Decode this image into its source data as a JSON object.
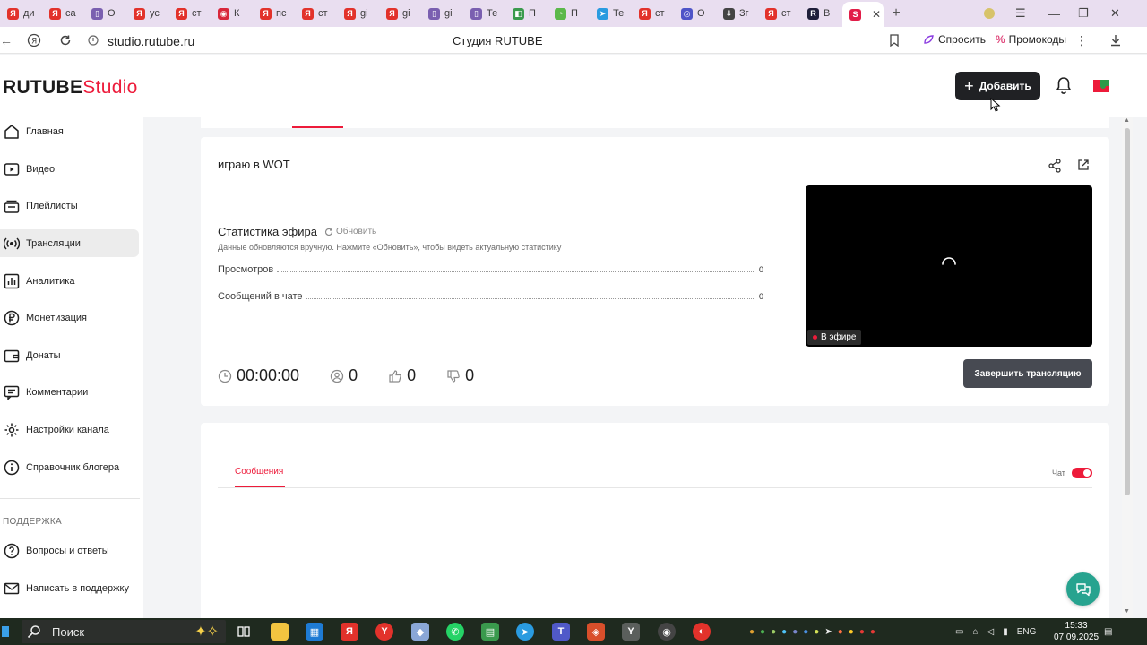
{
  "browser": {
    "tabs": [
      {
        "fav": "Я",
        "label": "ди",
        "color": "#e2322b"
      },
      {
        "fav": "Я",
        "label": "са",
        "color": "#e2322b"
      },
      {
        "fav": "▯",
        "label": "О",
        "color": "#7a5fb0"
      },
      {
        "fav": "Я",
        "label": "ус",
        "color": "#e2322b"
      },
      {
        "fav": "Я",
        "label": "ст",
        "color": "#e2322b"
      },
      {
        "fav": "◉",
        "label": "К",
        "color": "#d8263a"
      },
      {
        "fav": "Я",
        "label": "пс",
        "color": "#e2322b"
      },
      {
        "fav": "Я",
        "label": "ст",
        "color": "#e2322b"
      },
      {
        "fav": "Я",
        "label": "gi",
        "color": "#e2322b"
      },
      {
        "fav": "Я",
        "label": "gi",
        "color": "#e2322b"
      },
      {
        "fav": "▯",
        "label": "gi",
        "color": "#7a5fb0"
      },
      {
        "fav": "▯",
        "label": "Те",
        "color": "#7a5fb0"
      },
      {
        "fav": "◧",
        "label": "П",
        "color": "#3a9a4d"
      },
      {
        "fav": "◔",
        "label": "П",
        "color": "#5bb84a"
      },
      {
        "fav": "➤",
        "label": "Те",
        "color": "#2a9be0"
      },
      {
        "fav": "Я",
        "label": "ст",
        "color": "#e2322b"
      },
      {
        "fav": "◎",
        "label": "О",
        "color": "#4e54c8"
      },
      {
        "fav": "⇩",
        "label": "Зг",
        "color": "#444444"
      },
      {
        "fav": "Я",
        "label": "ст",
        "color": "#e2322b"
      },
      {
        "fav": "R",
        "label": "В",
        "color": "#1f1f3a"
      },
      {
        "fav": "S",
        "label": "",
        "color": "#e11d48",
        "active": true
      }
    ],
    "url": "studio.rutube.ru",
    "page_title": "Студия RUTUBE",
    "ask_label": "Спросить",
    "promo_label": "Промокоды"
  },
  "header": {
    "logo_main": "RUTUBE",
    "logo_studio": "Studio",
    "add_label": "Добавить"
  },
  "sidebar": {
    "items": [
      {
        "label": "Главная",
        "icon": "home-icon"
      },
      {
        "label": "Видео",
        "icon": "video-icon"
      },
      {
        "label": "Плейлисты",
        "icon": "playlist-icon"
      },
      {
        "label": "Трансляции",
        "icon": "broadcast-icon",
        "active": true
      },
      {
        "label": "Аналитика",
        "icon": "analytics-icon"
      },
      {
        "label": "Монетизация",
        "icon": "ruble-icon"
      },
      {
        "label": "Донаты",
        "icon": "wallet-icon"
      },
      {
        "label": "Комментарии",
        "icon": "comment-icon"
      },
      {
        "label": "Настройки канала",
        "icon": "gear-icon"
      },
      {
        "label": "Справочник блогера",
        "icon": "info-icon"
      }
    ],
    "support_heading": "ПОДДЕРЖКА",
    "support_items": [
      {
        "label": "Вопросы и ответы",
        "icon": "question-icon"
      },
      {
        "label": "Написать в поддержку",
        "icon": "mail-icon"
      }
    ]
  },
  "stream": {
    "title": "играю в WOT",
    "stats_heading": "Статистика эфира",
    "refresh_label": "Обновить",
    "stats_hint": "Данные обновляются вручную. Нажмите «Обновить», чтобы видеть актуальную статистику",
    "stats": [
      {
        "label": "Просмотров",
        "value": "0"
      },
      {
        "label": "Сообщений в чате",
        "value": "0"
      }
    ],
    "duration": "00:00:00",
    "viewers": "0",
    "likes": "0",
    "dislikes": "0",
    "live_label": "В эфире",
    "end_label": "Завершить трансляцию"
  },
  "chat": {
    "messages_tab": "Сообщения",
    "chat_label": "Чат",
    "enabled": true
  },
  "taskbar": {
    "search_label": "Поиск",
    "lang": "ENG",
    "time": "15:33",
    "date": "07.09.2025"
  },
  "colors": {
    "accent": "#ed1b3a",
    "dark_button": "#202124",
    "end_button": "#474a52",
    "help_fab": "#27a38f"
  }
}
